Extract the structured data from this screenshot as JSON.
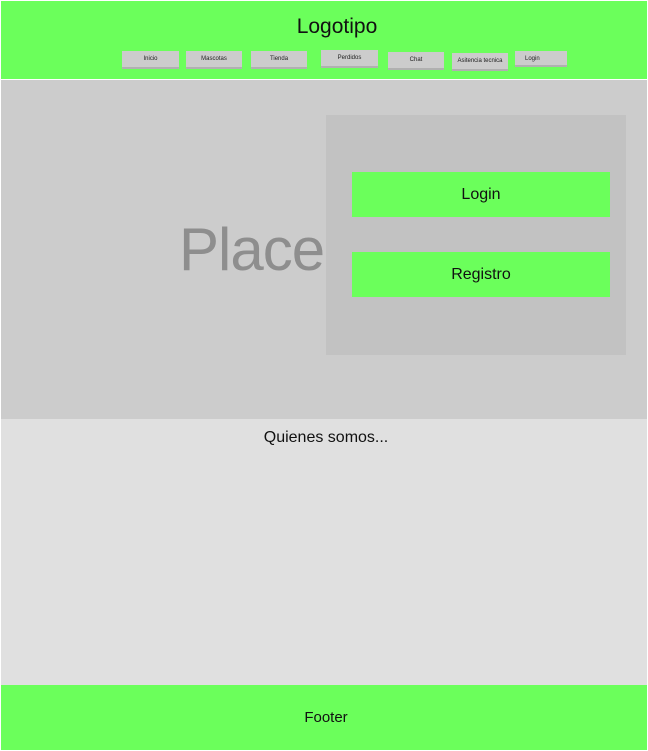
{
  "header": {
    "logo": "Logotipo",
    "nav": [
      "Inicio",
      "Mascotas",
      "Tienda",
      "Perdidos",
      "Chat",
      "Asitencia tecnica",
      "Login"
    ]
  },
  "hero": {
    "placeholder_text": "Placeh",
    "login_label": "Login",
    "register_label": "Registro"
  },
  "about": {
    "title": "Quienes somos..."
  },
  "footer": {
    "text": "Footer"
  },
  "colors": {
    "accent": "#6bff5b",
    "hero_bg": "#cccccc",
    "panel_bg": "#c2c2c2",
    "about_bg": "#e0e0e0"
  }
}
